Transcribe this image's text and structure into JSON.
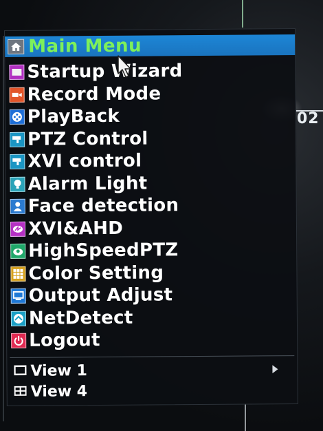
{
  "menu": {
    "title": "Main Menu",
    "items": [
      {
        "label": "Startup Wizard",
        "icon": "wizard-icon",
        "color": "#b02fc0"
      },
      {
        "label": "Record Mode",
        "icon": "record-icon",
        "color": "#e2552a"
      },
      {
        "label": "PlayBack",
        "icon": "playback-icon",
        "color": "#1e6fd8"
      },
      {
        "label": "PTZ Control",
        "icon": "ptz-camera-icon",
        "color": "#1b96c4"
      },
      {
        "label": "XVI control",
        "icon": "xvi-camera-icon",
        "color": "#1b96c4"
      },
      {
        "label": "Alarm Light",
        "icon": "alarm-light-icon",
        "color": "#2aa3b8"
      },
      {
        "label": "Face detection",
        "icon": "face-detection-icon",
        "color": "#2a7ad0"
      },
      {
        "label": "XVI&AHD",
        "icon": "xvi-ahd-icon",
        "color": "#b530c4"
      },
      {
        "label": "HighSpeedPTZ",
        "icon": "high-speed-ptz-icon",
        "color": "#1fa86a"
      },
      {
        "label": "Color Setting",
        "icon": "color-setting-icon",
        "color": "#d6a21e"
      },
      {
        "label": "Output Adjust",
        "icon": "output-adjust-icon",
        "color": "#1e78d6"
      },
      {
        "label": "NetDetect",
        "icon": "net-detect-icon",
        "color": "#1ba0c6"
      },
      {
        "label": "Logout",
        "icon": "power-icon",
        "color": "#e02a52"
      }
    ],
    "views": [
      {
        "label": "View 1",
        "icon": "single-view-icon",
        "has_submenu": true
      },
      {
        "label": "View 4",
        "icon": "quad-view-icon",
        "has_submenu": false
      }
    ]
  },
  "background": {
    "overlay_text": "02"
  },
  "colors": {
    "header_bg": "#1d86d6",
    "title_text": "#7ef05a",
    "item_text": "#ffffff",
    "menu_bg": "#0c0e12"
  }
}
